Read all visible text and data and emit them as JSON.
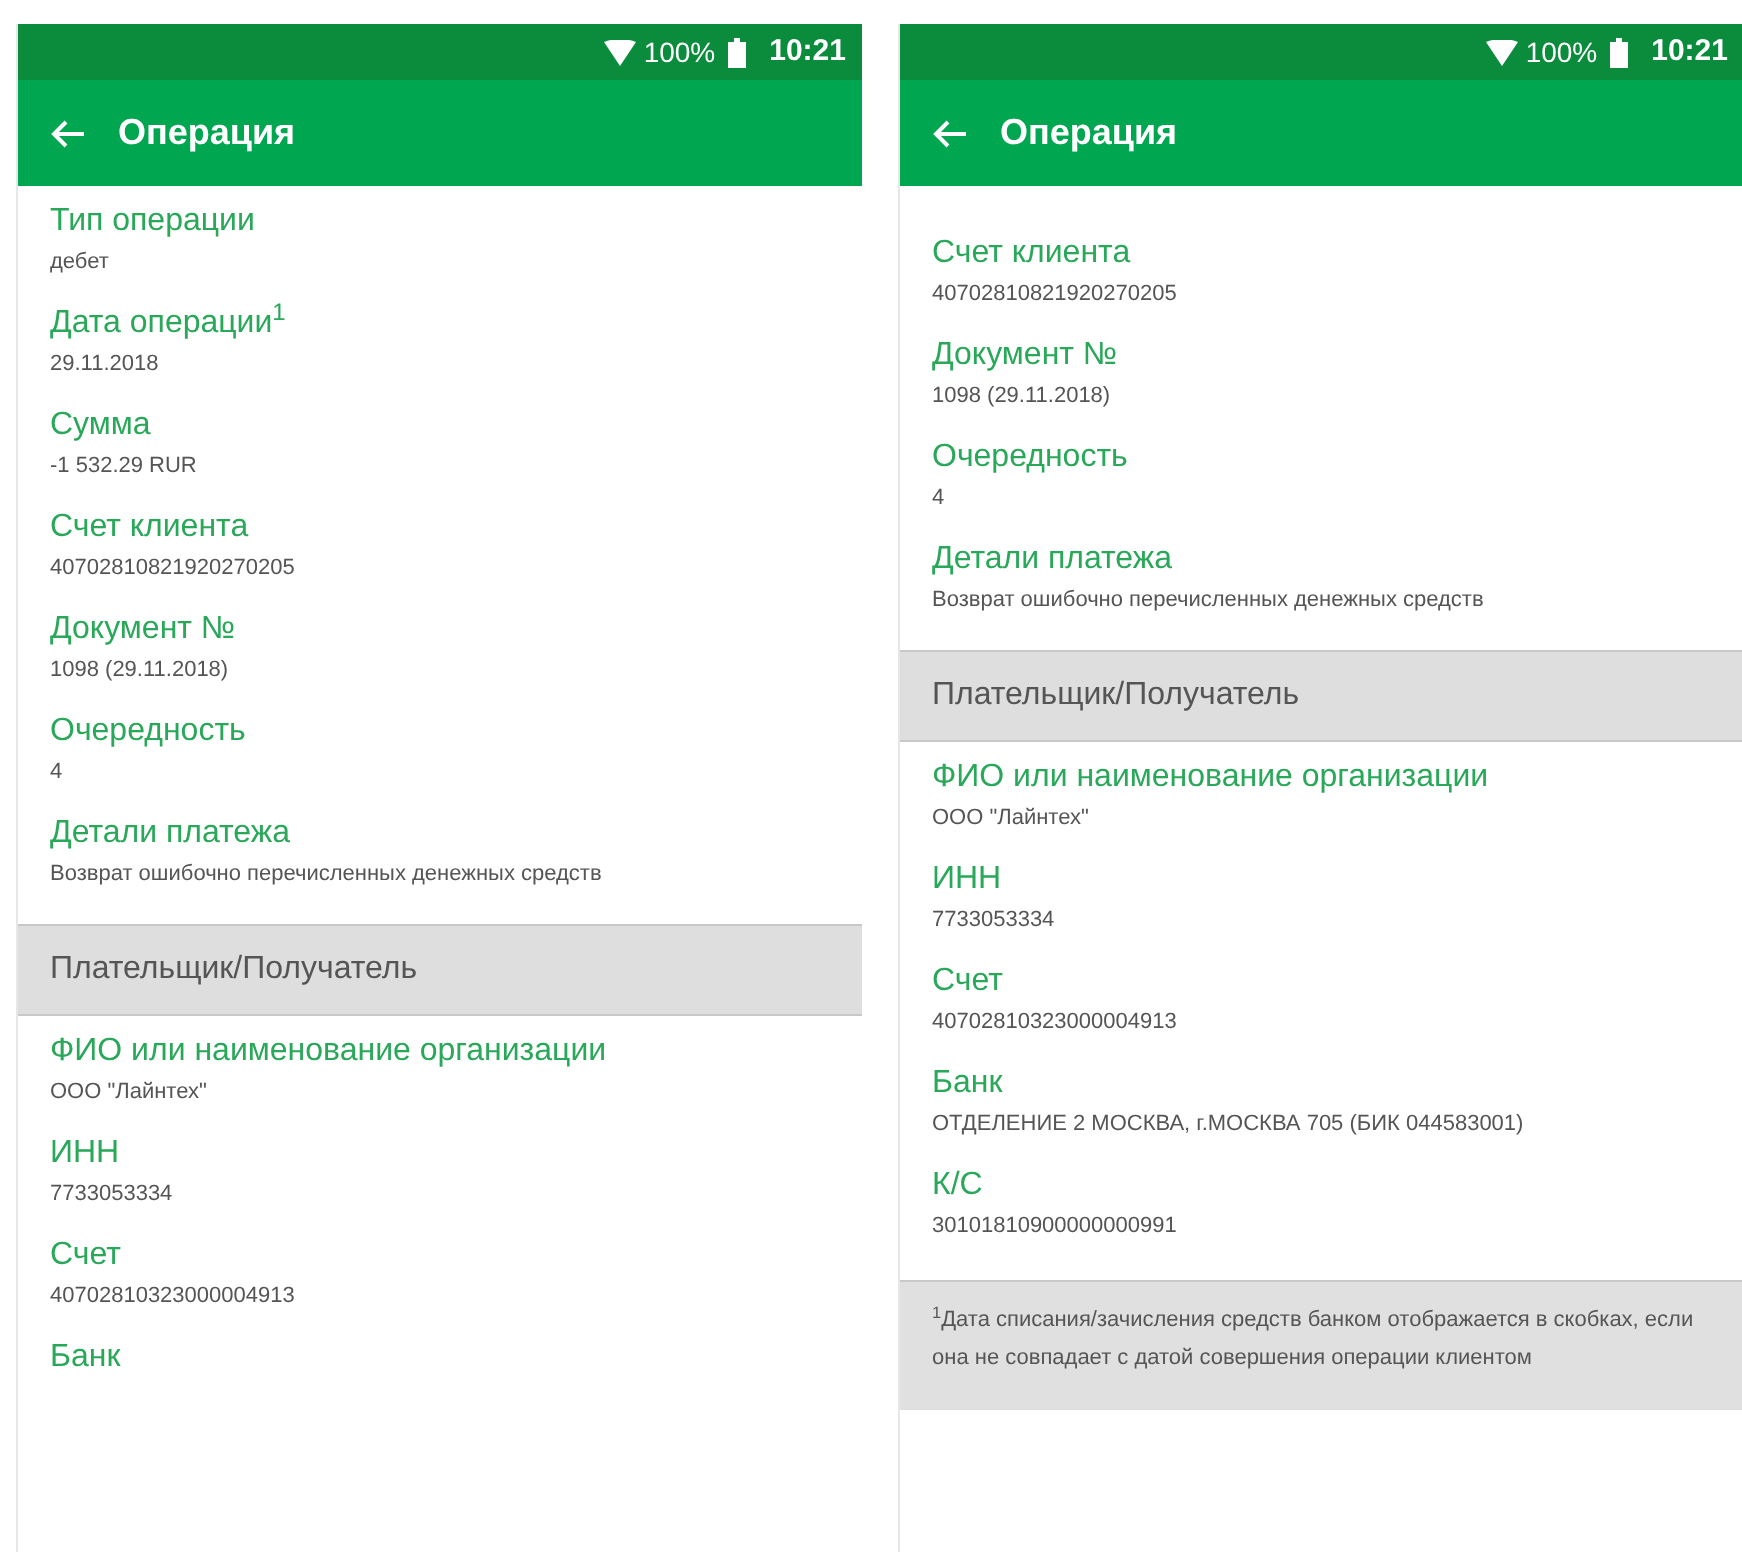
{
  "screens": [
    {
      "status_bar": {
        "battery": "100%",
        "time": "10:21"
      },
      "toolbar": {
        "title": "Операция"
      },
      "items": [
        {
          "kind": "field",
          "label": "Тип операции",
          "value": "дебет"
        },
        {
          "kind": "field",
          "label": "Дата операции$^{1}$",
          "value": "29.11.2018"
        },
        {
          "kind": "field",
          "label": "Сумма",
          "value": "-1 532.29 RUR"
        },
        {
          "kind": "field",
          "label": "Счет клиента",
          "value": "40702810821920270205"
        },
        {
          "kind": "field",
          "label": "Документ №",
          "value": "1098 (29.11.2018)"
        },
        {
          "kind": "field",
          "label": "Очередность",
          "value": "4"
        },
        {
          "kind": "field",
          "label": "Детали платежа",
          "value": "Возврат ошибочно перечисленных денежных средств"
        },
        {
          "kind": "section",
          "label": "Плательщик/Получатель"
        },
        {
          "kind": "field",
          "label": "ФИО или наименование организации",
          "value": "ООО \"Лайнтех\""
        },
        {
          "kind": "field",
          "label": "ИНН",
          "value": "7733053334"
        },
        {
          "kind": "field",
          "label": "Счет",
          "value": "40702810323000004913"
        },
        {
          "kind": "field",
          "label": "Банк"
        }
      ]
    },
    {
      "status_bar": {
        "battery": "100%",
        "time": "10:21"
      },
      "toolbar": {
        "title": "Операция"
      },
      "items": [
        {
          "kind": "field",
          "label": "Счет клиента",
          "value": "40702810821920270205"
        },
        {
          "kind": "field",
          "label": "Документ №",
          "value": "1098 (29.11.2018)"
        },
        {
          "kind": "field",
          "label": "Очередность",
          "value": "4"
        },
        {
          "kind": "field",
          "label": "Детали платежа",
          "value": "Возврат ошибочно перечисленных денежных средств"
        },
        {
          "kind": "section",
          "label": "Плательщик/Получатель"
        },
        {
          "kind": "field",
          "label": "ФИО или наименование организации",
          "value": "ООО \"Лайнтех\""
        },
        {
          "kind": "field",
          "label": "ИНН",
          "value": "7733053334"
        },
        {
          "kind": "field",
          "label": "Счет",
          "value": "40702810323000004913"
        },
        {
          "kind": "field",
          "label": "Банк",
          "value": "ОТДЕЛЕНИЕ 2 МОСКВА, г.МОСКВА 705 (БИК 044583001)"
        },
        {
          "kind": "field",
          "label": "К/С",
          "value": "30101810900000000991"
        },
        {
          "kind": "footnote",
          "text": "$^{1}$Дата списания/зачисления средств банком отображается в скобках, если она не совпадает с датой совершения операции клиентом"
        }
      ]
    }
  ]
}
